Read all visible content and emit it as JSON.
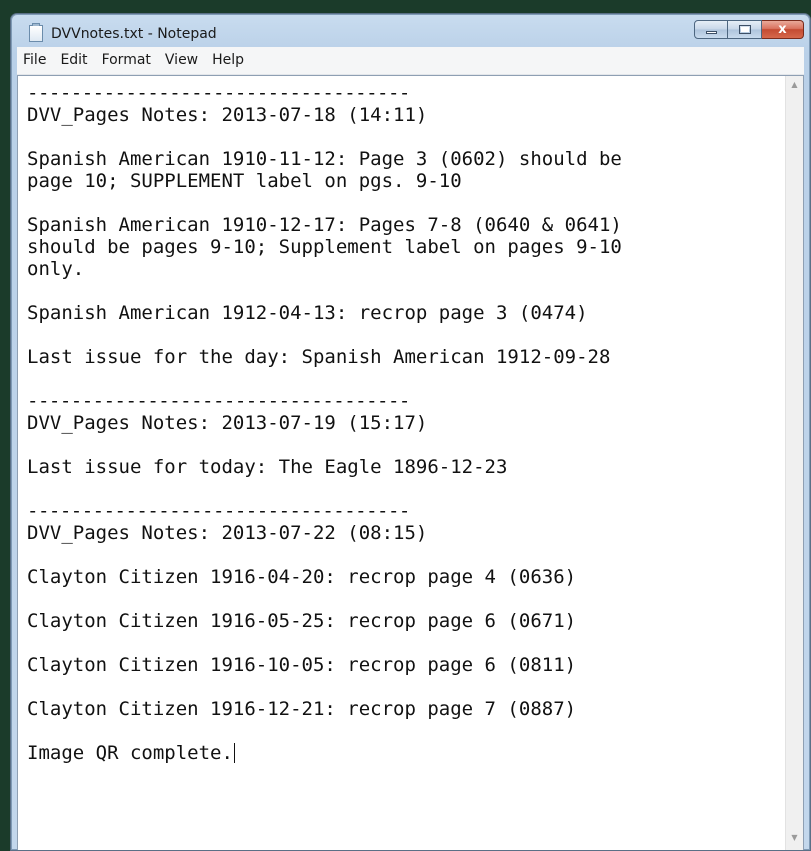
{
  "window": {
    "title": "DVVnotes.txt - Notepad",
    "controls": {
      "minimize": "",
      "maximize": "",
      "close": "x"
    }
  },
  "menu": [
    "File",
    "Edit",
    "Format",
    "View",
    "Help"
  ],
  "document": {
    "lines": [
      "-----------------------------------",
      "DVV_Pages Notes: 2013-07-18 (14:11)",
      "",
      "Spanish American 1910-11-12: Page 3 (0602) should be",
      "page 10; SUPPLEMENT label on pgs. 9-10",
      "",
      "Spanish American 1910-12-17: Pages 7-8 (0640 & 0641)",
      "should be pages 9-10; Supplement label on pages 9-10",
      "only.",
      "",
      "Spanish American 1912-04-13: recrop page 3 (0474)",
      "",
      "Last issue for the day: Spanish American 1912-09-28",
      "",
      "-----------------------------------",
      "DVV_Pages Notes: 2013-07-19 (15:17)",
      "",
      "Last issue for today: The Eagle 1896-12-23",
      "",
      "-----------------------------------",
      "DVV_Pages Notes: 2013-07-22 (08:15)",
      "",
      "Clayton Citizen 1916-04-20: recrop page 4 (0636)",
      "",
      "Clayton Citizen 1916-05-25: recrop page 6 (0671)",
      "",
      "Clayton Citizen 1916-10-05: recrop page 6 (0811)",
      "",
      "Clayton Citizen 1916-12-21: recrop page 7 (0887)",
      "",
      "Image QR complete."
    ]
  },
  "icons": {
    "app": "notepad-icon",
    "scroll_up": "scroll-up-arrow-icon",
    "scroll_down": "scroll-down-arrow-icon"
  }
}
